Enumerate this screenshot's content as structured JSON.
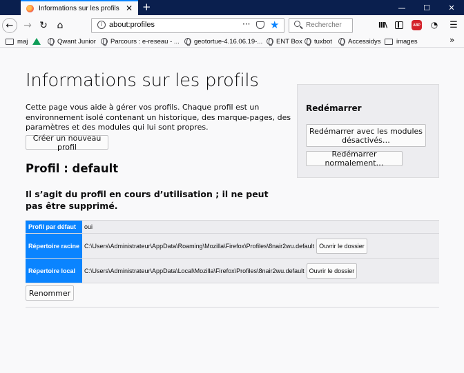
{
  "browser": {
    "tab_title": "Informations sur les profils",
    "tab_close": "✕",
    "new_tab": "+",
    "window_minimize": "—",
    "window_maximize": "☐",
    "window_close": "✕",
    "url": "about:profiles",
    "url_more": "···",
    "search_placeholder": "Rechercher",
    "abp_label": "ABP",
    "bookmarks": [
      {
        "label": "maj",
        "icon": "folder-icon"
      },
      {
        "label": "",
        "icon": "google-drive-icon"
      },
      {
        "label": "Qwant Junior",
        "icon": "globe-icon"
      },
      {
        "label": "Parcours : e-reseau - ...",
        "icon": "globe-icon"
      },
      {
        "label": "geotortue-4.16.06.19-...",
        "icon": "globe-icon"
      },
      {
        "label": "ENT Box",
        "icon": "globe-icon"
      },
      {
        "label": "tuxbot",
        "icon": "globe-icon"
      },
      {
        "label": "Accessidys",
        "icon": "globe-icon"
      },
      {
        "label": "images",
        "icon": "folder-icon"
      }
    ],
    "bookmarks_more": "»"
  },
  "page": {
    "title": "Informations sur les profils",
    "description": "Cette page vous aide à gérer vos profils. Chaque profil est un environnement isolé contenant un historique, des marque-pages, des paramètres et des modules qui lui sont propres.",
    "create_button": "Créer un nouveau profil",
    "profile_heading": "Profil : default",
    "profile_warning": "Il s’agit du profil en cours d’utilisation ; il ne peut pas être supprimé.",
    "table": {
      "default_label": "Profil par défaut",
      "default_value": "oui",
      "root_label": "Répertoire racine",
      "root_value": "C:\\Users\\Administrateur\\AppData\\Roaming\\Mozilla\\Firefox\\Profiles\\8nair2wu.default",
      "local_label": "Répertoire local",
      "local_value": "C:\\Users\\Administrateur\\AppData\\Local\\Mozilla\\Firefox\\Profiles\\8nair2wu.default",
      "open_folder": "Ouvrir le dossier"
    },
    "rename_button": "Renommer",
    "restart": {
      "heading": "Redémarrer",
      "safe_mode_button": "Redémarrer avec les modules désactivés…",
      "normal_button": "Redémarrer normalement…"
    }
  },
  "colors": {
    "accent": "#0a84ff",
    "titlebar": "#0a1f4e",
    "abp": "#d4232b"
  }
}
